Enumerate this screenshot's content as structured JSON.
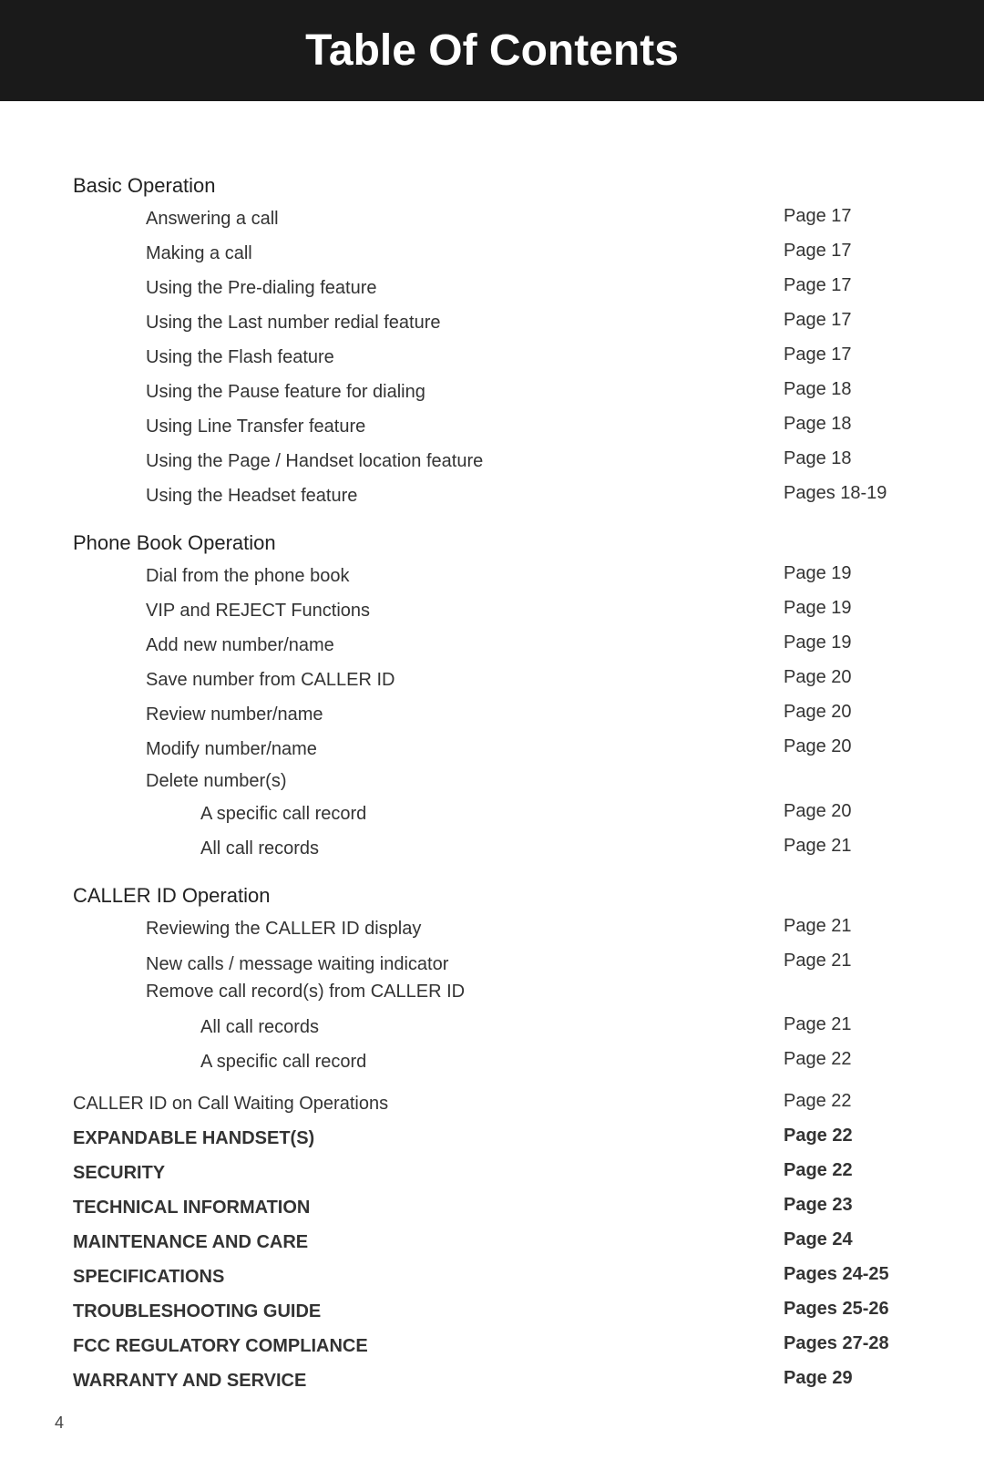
{
  "header": {
    "title": "Table Of Contents"
  },
  "page_number": "4",
  "sections": [
    {
      "id": "basic-operation",
      "label": "Basic Operation",
      "bold": false,
      "entries": [
        {
          "text": "Answering a call",
          "page": "Page 17",
          "indent": "normal"
        },
        {
          "text": "Making a call",
          "page": "Page 17",
          "indent": "normal"
        },
        {
          "text": "Using the Pre-dialing feature",
          "page": "Page 17",
          "indent": "normal"
        },
        {
          "text": "Using the Last number redial feature",
          "page": "Page 17",
          "indent": "normal"
        },
        {
          "text": "Using the Flash feature",
          "page": "Page 17",
          "indent": "normal"
        },
        {
          "text": "Using the Pause feature for dialing",
          "page": "Page 18",
          "indent": "normal"
        },
        {
          "text": "Using Line Transfer feature",
          "page": "Page 18",
          "indent": "normal"
        },
        {
          "text": "Using the Page / Handset location feature",
          "page": "Page 18",
          "indent": "normal"
        },
        {
          "text": "Using the Headset feature",
          "page": "Pages 18-19",
          "indent": "normal"
        }
      ]
    },
    {
      "id": "phone-book-operation",
      "label": "Phone Book Operation",
      "bold": false,
      "entries": [
        {
          "text": "Dial from the phone book",
          "page": "Page 19",
          "indent": "normal"
        },
        {
          "text": "VIP and REJECT Functions",
          "page": "Page 19",
          "indent": "normal"
        },
        {
          "text": "Add new number/name",
          "page": "Page 19",
          "indent": "normal"
        },
        {
          "text": "Save number from CALLER ID",
          "page": "Page 20",
          "indent": "normal"
        },
        {
          "text": "Review number/name",
          "page": "Page 20",
          "indent": "normal"
        },
        {
          "text": "Modify number/name",
          "page": "Page 20",
          "indent": "normal"
        }
      ],
      "delete_section": {
        "label": "Delete number(s)",
        "sub_entries": [
          {
            "text": "A specific call record",
            "page": "Page 20"
          },
          {
            "text": "All call records",
            "page": "Page 21"
          }
        ]
      }
    },
    {
      "id": "caller-id-operation",
      "label": "CALLER ID Operation",
      "bold": false,
      "entries": [
        {
          "text": "Reviewing the CALLER ID display",
          "page": "Page 21",
          "indent": "normal"
        },
        {
          "text": "New calls / message waiting indicator\nRemove call record(s) from CALLER ID",
          "page": "Page 21",
          "indent": "normal",
          "multiline": true
        }
      ],
      "delete_section": {
        "label": null,
        "sub_entries": [
          {
            "text": "All call records",
            "page": "Page 21"
          },
          {
            "text": "A specific call record",
            "page": "Page 22"
          }
        ]
      }
    }
  ],
  "bottom_entries": [
    {
      "text": "CALLER ID on Call Waiting Operations",
      "page": "Page 22",
      "bold": false
    },
    {
      "text": "EXPANDABLE HANDSET(S)",
      "page": "Page 22",
      "bold": true
    },
    {
      "text": "SECURITY",
      "page": "Page 22",
      "bold": true
    },
    {
      "text": "TECHNICAL INFORMATION",
      "page": "Page 23",
      "bold": true
    },
    {
      "text": "MAINTENANCE AND CARE",
      "page": "Page 24",
      "bold": true
    },
    {
      "text": "SPECIFICATIONS",
      "page": "Pages 24-25",
      "bold": true
    },
    {
      "text": "TROUBLESHOOTING GUIDE",
      "page": "Pages 25-26",
      "bold": true
    },
    {
      "text": "FCC REGULATORY COMPLIANCE",
      "page": "Pages 27-28",
      "bold": true
    },
    {
      "text": "WARRANTY AND SERVICE",
      "page": "Page 29",
      "bold": true
    }
  ]
}
